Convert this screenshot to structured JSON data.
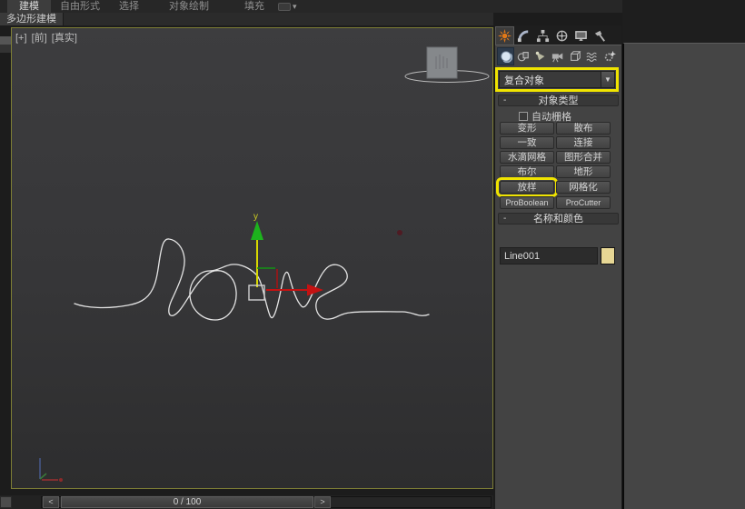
{
  "ribbon": {
    "tabs": [
      "建模",
      "自由形式",
      "选择",
      "对象绘制",
      "填充"
    ],
    "active_tab": "建模",
    "panel_tab": "多边形建模",
    "overflow_arrow": "▾"
  },
  "viewport": {
    "labels": {
      "menu": "[+]",
      "view": "[前]",
      "shading": "[真实]"
    },
    "gizmo_axis_label": "y"
  },
  "command_panel": {
    "tab_icons": [
      "create-icon",
      "modify-icon",
      "hierarchy-icon",
      "motion-icon",
      "display-icon",
      "utilities-icon"
    ],
    "active_tab_icon": "create-icon",
    "category_icons": [
      "geometry-icon",
      "shapes-icon",
      "lights-icon",
      "cameras-icon",
      "helpers-icon",
      "spacewarps-icon",
      "systems-icon"
    ],
    "active_category_icon": "geometry-icon",
    "category_dropdown": {
      "value": "复合对象",
      "arrow": "▼",
      "highlight_color": "#f0e400"
    },
    "object_type": {
      "title": "对象类型",
      "collapse_glyph": "-",
      "autogrid": {
        "label": "自动栅格",
        "checked": false
      },
      "buttons": [
        "变形",
        "散布",
        "一致",
        "连接",
        "水滴网格",
        "图形合并",
        "布尔",
        "地形",
        "放样",
        "网格化",
        "ProBoolean",
        "ProCutter"
      ],
      "highlighted_button": "放样",
      "highlight_color": "#f0e400"
    },
    "name_color": {
      "title": "名称和颜色",
      "collapse_glyph": "-",
      "name_value": "Line001",
      "color_swatch": "#e7d795"
    }
  },
  "timeline": {
    "prev_label": "<",
    "frame_label": "0 / 100",
    "next_label": ">"
  },
  "colors": {
    "viewport_border": "#7e7e35",
    "spline": "#e4e4e4",
    "gizmo_y_arrow": "#1db31d",
    "gizmo_y_stem": "#d8d800",
    "gizmo_x": "#c41212",
    "highlight": "#f0e400"
  }
}
